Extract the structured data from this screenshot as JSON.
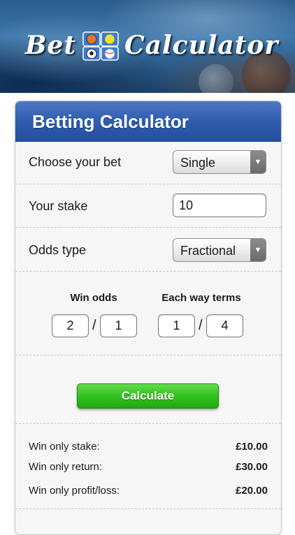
{
  "banner": {
    "logo_left": "Bet",
    "logo_right": "Calculator"
  },
  "card": {
    "title": "Betting Calculator"
  },
  "form": {
    "bet_type_label": "Choose your bet",
    "bet_type_value": "Single",
    "stake_label": "Your stake",
    "stake_value": "10",
    "odds_type_label": "Odds type",
    "odds_type_value": "Fractional",
    "win_odds_title": "Win odds",
    "win_odds_numerator": "2",
    "win_odds_denominator": "1",
    "each_way_title": "Each way terms",
    "each_way_numerator": "1",
    "each_way_denominator": "4",
    "slash": "/",
    "calculate_label": "Calculate"
  },
  "results": [
    {
      "label": "Win only stake:",
      "value": "£10.00"
    },
    {
      "label": "Win only return:",
      "value": "£30.00"
    },
    {
      "label": "Win only profit/loss:",
      "value": "£20.00"
    }
  ],
  "colors": {
    "header_blue": "#2f5cae",
    "button_green": "#34c41f"
  },
  "icons": {
    "logo": "sports-balls-icon",
    "dropdown": "triangle-down-icon"
  }
}
